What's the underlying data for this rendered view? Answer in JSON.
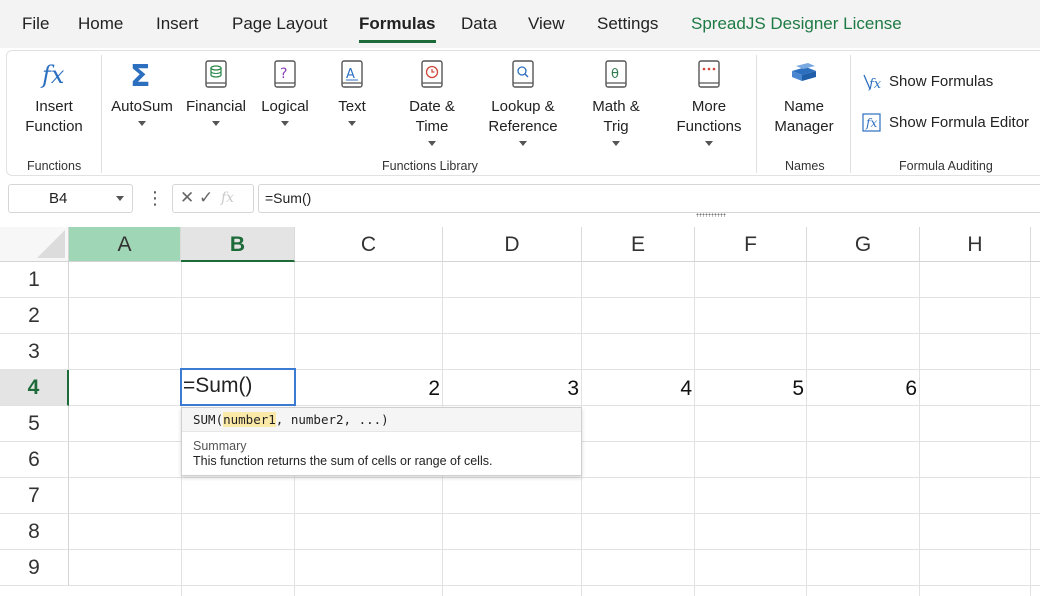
{
  "menu": {
    "tabs": [
      {
        "label": "File"
      },
      {
        "label": "Home"
      },
      {
        "label": "Insert"
      },
      {
        "label": "Page Layout"
      },
      {
        "label": "Formulas"
      },
      {
        "label": "Data"
      },
      {
        "label": "View"
      },
      {
        "label": "Settings"
      },
      {
        "label": "SpreadJS Designer License"
      }
    ],
    "active_tab": "Formulas"
  },
  "ribbon": {
    "insert_function": {
      "line1": "Insert",
      "line2": "Function",
      "icon": "fx-icon"
    },
    "functions_group_label": "Functions",
    "library": {
      "autosum": {
        "line1": "AutoSum",
        "icon": "sigma-icon"
      },
      "financial": {
        "line1": "Financial",
        "icon": "financial-book-icon"
      },
      "logical": {
        "line1": "Logical",
        "icon": "logical-book-icon"
      },
      "text": {
        "line1": "Text",
        "icon": "text-book-icon"
      },
      "datetime": {
        "line1": "Date &",
        "line2": "Time",
        "icon": "clock-book-icon"
      },
      "lookup": {
        "line1": "Lookup &",
        "line2": "Reference",
        "icon": "lookup-book-icon"
      },
      "math": {
        "line1": "Math &",
        "line2": "Trig",
        "icon": "theta-book-icon"
      },
      "more": {
        "line1": "More",
        "line2": "Functions",
        "icon": "more-book-icon"
      }
    },
    "library_group_label": "Functions Library",
    "name_manager": {
      "line1": "Name",
      "line2": "Manager",
      "icon": "name-manager-icon"
    },
    "names_group_label": "Names",
    "show_formulas": "Show Formulas",
    "show_formula_editor": "Show Formula Editor",
    "auditing_group_label": "Formula Auditing"
  },
  "formula_bar": {
    "name_box": "B4",
    "cancel_glyph": "✕",
    "enter_glyph": "✓",
    "fx_glyph": "fx",
    "formula": "=Sum()"
  },
  "sheet": {
    "columns": [
      "A",
      "B",
      "C",
      "D",
      "E",
      "F",
      "G",
      "H"
    ],
    "rows": [
      "1",
      "2",
      "3",
      "4",
      "5",
      "6",
      "7",
      "8",
      "9"
    ],
    "active_cell": "B4",
    "active_cell_text": "=Sum()",
    "row4_values": {
      "C": "2",
      "D": "3",
      "E": "4",
      "F": "5",
      "G": "6"
    }
  },
  "tooltip": {
    "fn": "SUM(",
    "arg1": "number1",
    "rest": ", number2, ...)",
    "summary_title": "Summary",
    "summary_text": "This function returns the sum of cells or range of cells."
  },
  "colors": {
    "accent": "#1e6b3a",
    "selected_column_header": "#9fd6b5",
    "active_cell_border": "#3b7bd1",
    "license_tab": "#1e7a44"
  }
}
